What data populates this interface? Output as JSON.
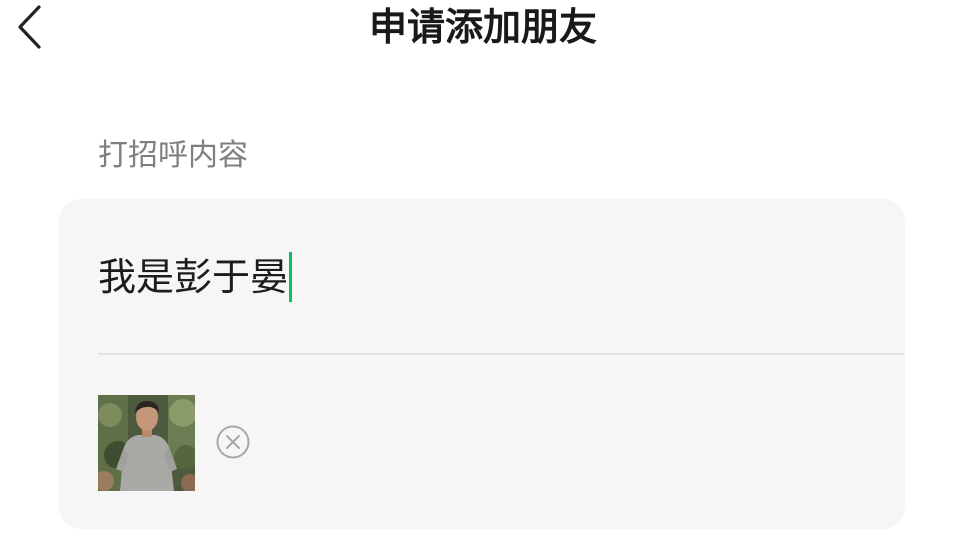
{
  "nav": {
    "back_icon": "chevron-left-icon",
    "title": "申请添加朋友"
  },
  "greeting": {
    "section_label": "打招呼内容",
    "value": "我是彭于晏",
    "caret_color": "#07c160"
  },
  "attachment": {
    "photo": "person-photo",
    "remove_icon": "circle-x-icon"
  },
  "colors": {
    "card_background": "#f6f6f6",
    "accent": "#07c160",
    "label_gray": "#7f7f7f"
  }
}
